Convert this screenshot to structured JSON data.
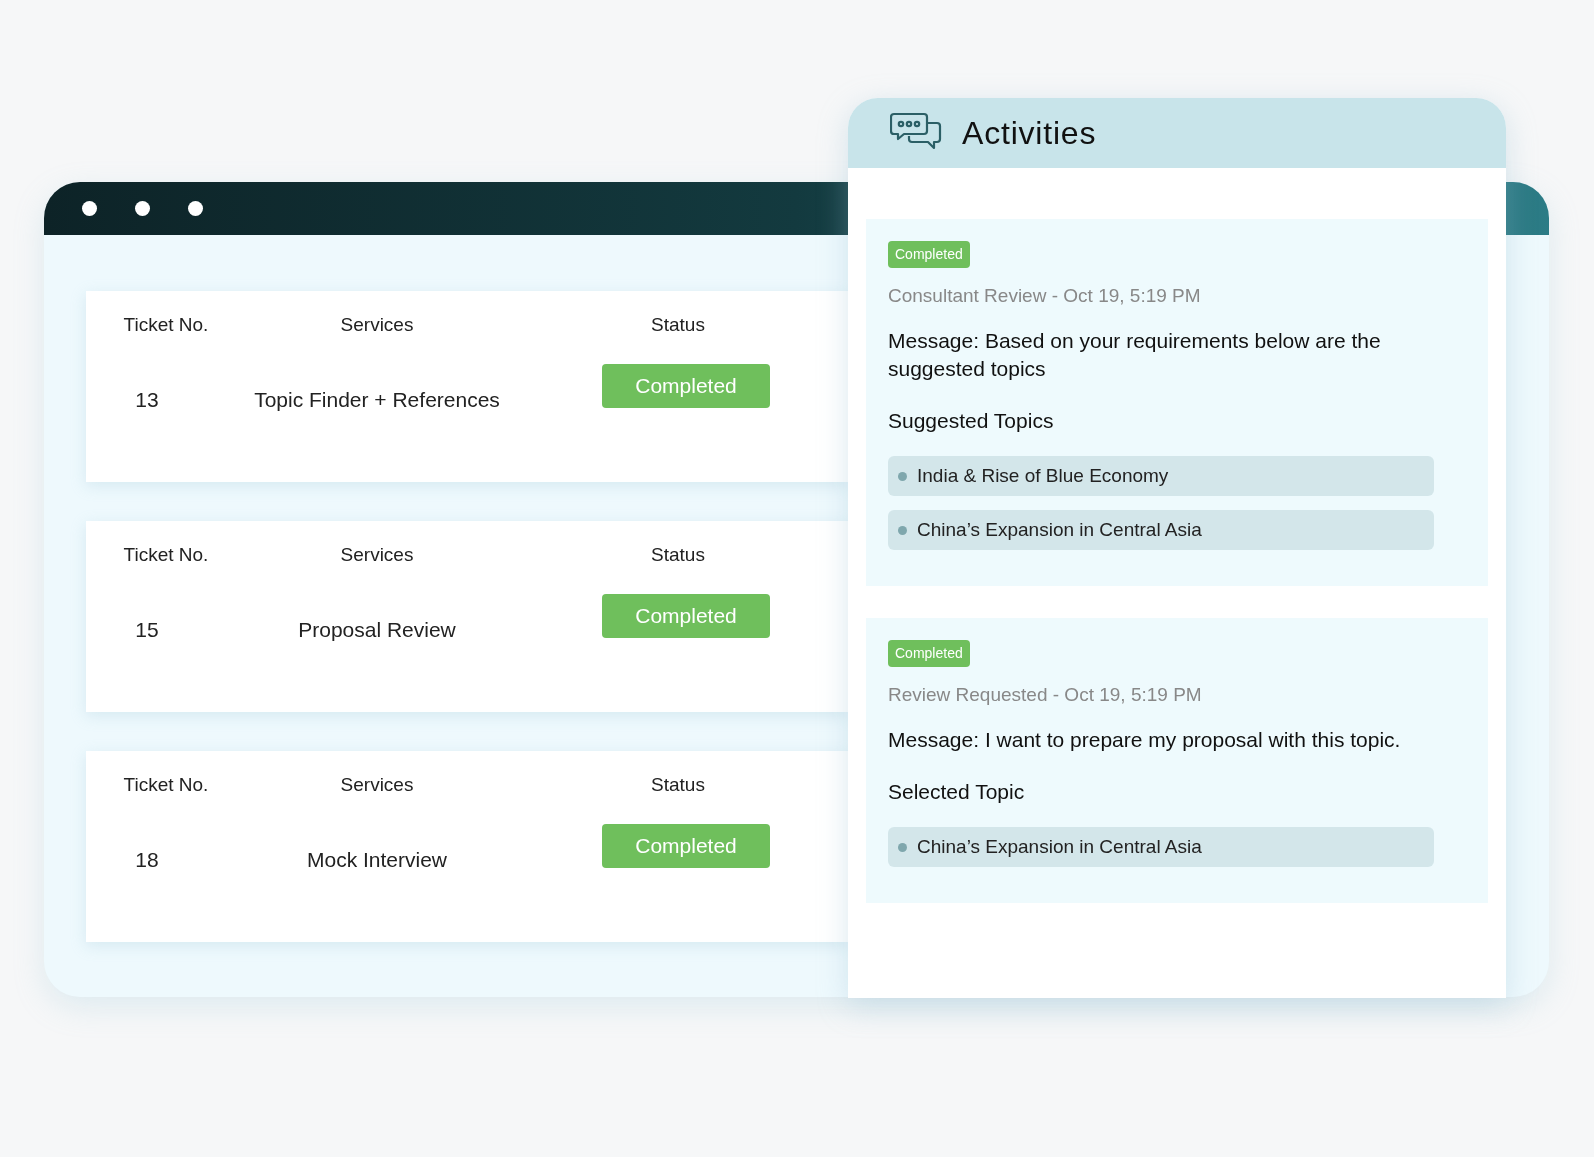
{
  "tickets": [
    {
      "ticket_label": "Ticket No.",
      "services_label": "Services",
      "status_label": "Status",
      "number": "13",
      "service": "Topic Finder + References",
      "status": "Completed"
    },
    {
      "ticket_label": "Ticket No.",
      "services_label": "Services",
      "status_label": "Status",
      "number": "15",
      "service": "Proposal Review",
      "status": "Completed"
    },
    {
      "ticket_label": "Ticket No.",
      "services_label": "Services",
      "status_label": "Status",
      "number": "18",
      "service": "Mock Interview",
      "status": "Completed"
    }
  ],
  "activities": {
    "title": "Activities",
    "entries": [
      {
        "badge": "Completed",
        "meta": "Consultant Review - Oct 19, 5:19 PM",
        "message": "Message: Based on your requirements below are the suggested topics",
        "section_title": "Suggested Topics",
        "topics": [
          "India & Rise of Blue Economy",
          "China’s Expansion in Central Asia"
        ]
      },
      {
        "badge": "Completed",
        "meta": "Review Requested - Oct 19, 5:19 PM",
        "message": "Message: I want to prepare my proposal with this topic.",
        "section_title": "Selected Topic",
        "topics": [
          "China’s Expansion in Central Asia"
        ]
      }
    ]
  }
}
